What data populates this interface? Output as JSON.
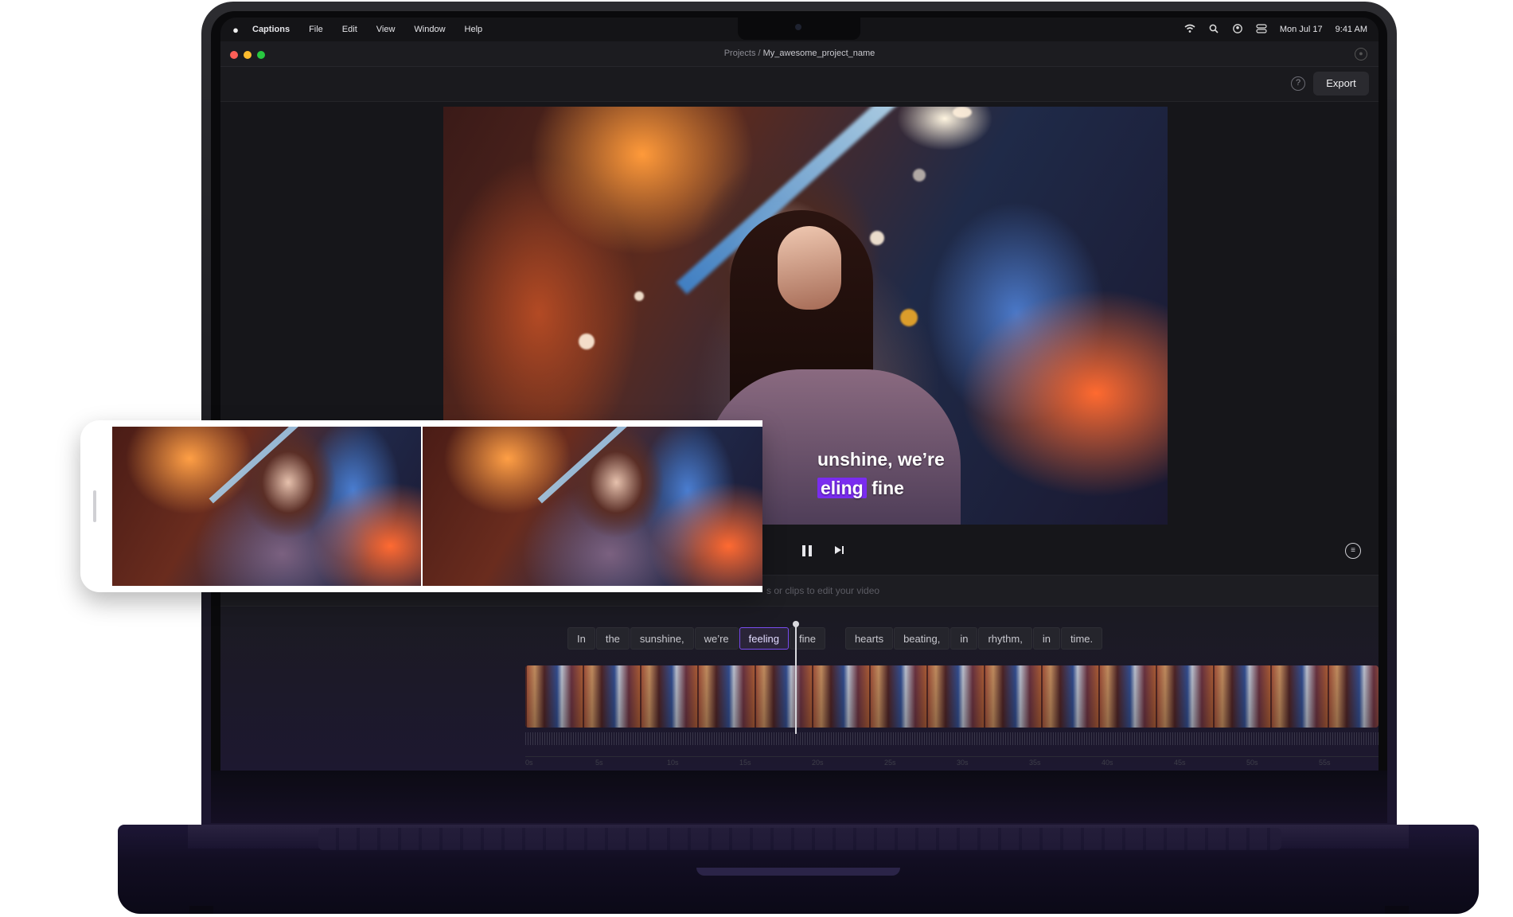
{
  "menubar": {
    "apple_icon": "apple-logo-icon",
    "app_name": "Captions",
    "menus": [
      "File",
      "Edit",
      "View",
      "Window",
      "Help"
    ],
    "status_icons": [
      "wifi-icon",
      "search-icon",
      "user-icon",
      "control-center-icon"
    ],
    "date": "Mon Jul 17",
    "time": "9:41 AM"
  },
  "titlebar": {
    "breadcrumb_root": "Projects",
    "separator": "/",
    "project_name": "My_awesome_project_name"
  },
  "toolbar": {
    "help_icon": "question-circle-icon",
    "export_label": "Export"
  },
  "video": {
    "caption_line1": "unshine, we’re",
    "caption_highlight": "eling",
    "caption_rest": "fine",
    "highlight_color": "#7a2cf0"
  },
  "controls": {
    "play_state": "playing",
    "icons": [
      "pause-icon",
      "skip-forward-icon",
      "captions-style-icon"
    ]
  },
  "hint": {
    "text": "s or clips to edit your video"
  },
  "transcript": {
    "words": [
      "In",
      "the",
      "sunshine,",
      "we’re",
      "feeling",
      "fine",
      "hearts",
      "beating,",
      "in",
      "rhythm,",
      "in",
      "time."
    ],
    "active_word": "feeling"
  },
  "ruler": {
    "ticks": [
      "0s",
      "5s",
      "10s",
      "15s",
      "20s",
      "25s",
      "30s",
      "35s",
      "40s",
      "45s",
      "50s",
      "55s"
    ]
  },
  "colors": {
    "accent": "#7a4df0",
    "traffic_red": "#ff5f57",
    "traffic_yellow": "#febc2e",
    "traffic_green": "#28c840"
  }
}
